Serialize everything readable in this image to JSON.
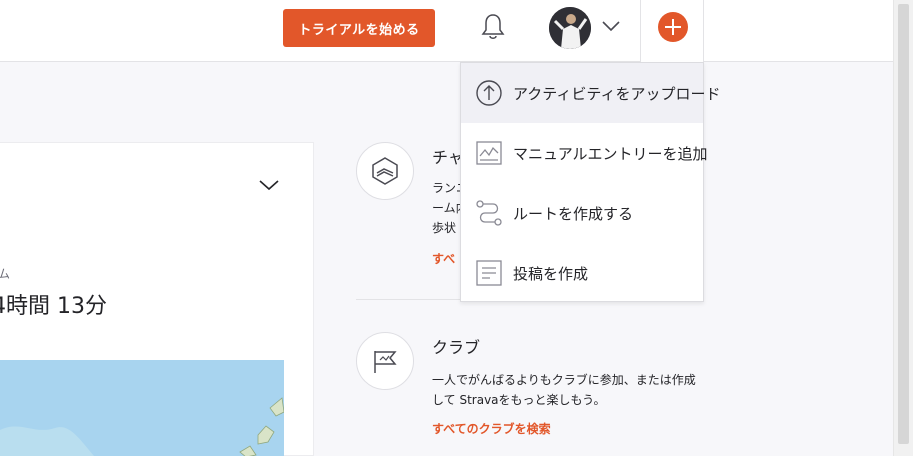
{
  "header": {
    "trial_button": "トライアルを始める"
  },
  "card": {
    "small_label": "ム",
    "value": "4時間 13分"
  },
  "sidebar": {
    "challenge": {
      "title": "チャ",
      "desc_lines": [
        "ランニ",
        "ーム内",
        "歩状"
      ],
      "link": "すべ"
    },
    "club": {
      "title": "クラブ",
      "desc": "一人でがんばるよりもクラブに参加、または作成して Stravaをもっと楽しもう。",
      "link": "すべてのクラブを検索"
    }
  },
  "dropdown": {
    "items": [
      {
        "label": "アクティビティをアップロード",
        "icon": "upload-icon"
      },
      {
        "label": "マニュアルエントリーを追加",
        "icon": "manual-entry-icon"
      },
      {
        "label": "ルートを作成する",
        "icon": "route-icon"
      },
      {
        "label": "投稿を作成",
        "icon": "post-icon"
      }
    ]
  },
  "colors": {
    "accent": "#e2572a",
    "menu_active_bg": "#f0f0f5",
    "map_water": "#a8d4ef"
  }
}
